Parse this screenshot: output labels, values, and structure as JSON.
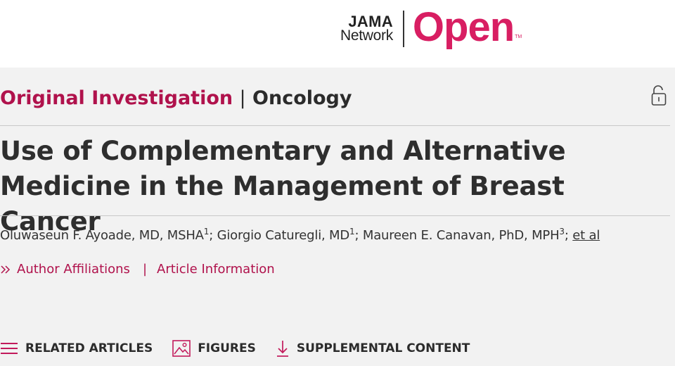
{
  "logo": {
    "jama": "JAMA",
    "network": "Network",
    "open": "Open",
    "tm": "TM",
    "brand_color": "#d81e62"
  },
  "article": {
    "type": "Original Investigation",
    "separator": "|",
    "topic": "Oncology",
    "access_icon": "open-lock-icon",
    "title": "Use of Complementary and Alternative Medicine in the Management of Breast Cancer",
    "authors": [
      {
        "name": "Oluwaseun F. Ayoade, MD, MSHA",
        "sup": "1",
        "sep": "; "
      },
      {
        "name": "Giorgio Caturegli, MD",
        "sup": "1",
        "sep": "; "
      },
      {
        "name": "Maureen E. Canavan, PhD, MPH",
        "sup": "3",
        "sep": "; "
      }
    ],
    "et_al": "et al",
    "affiliations_link": "Author Affiliations",
    "info_separator": "|",
    "info_link": "Article Information",
    "accent_color": "#b0124c"
  },
  "tools": {
    "related": {
      "label": "RELATED ARTICLES",
      "icon": "list-icon"
    },
    "figures": {
      "label": "FIGURES",
      "icon": "image-icon"
    },
    "supplemental": {
      "label": "SUPPLEMENTAL CONTENT",
      "icon": "download-arrow-icon"
    }
  }
}
